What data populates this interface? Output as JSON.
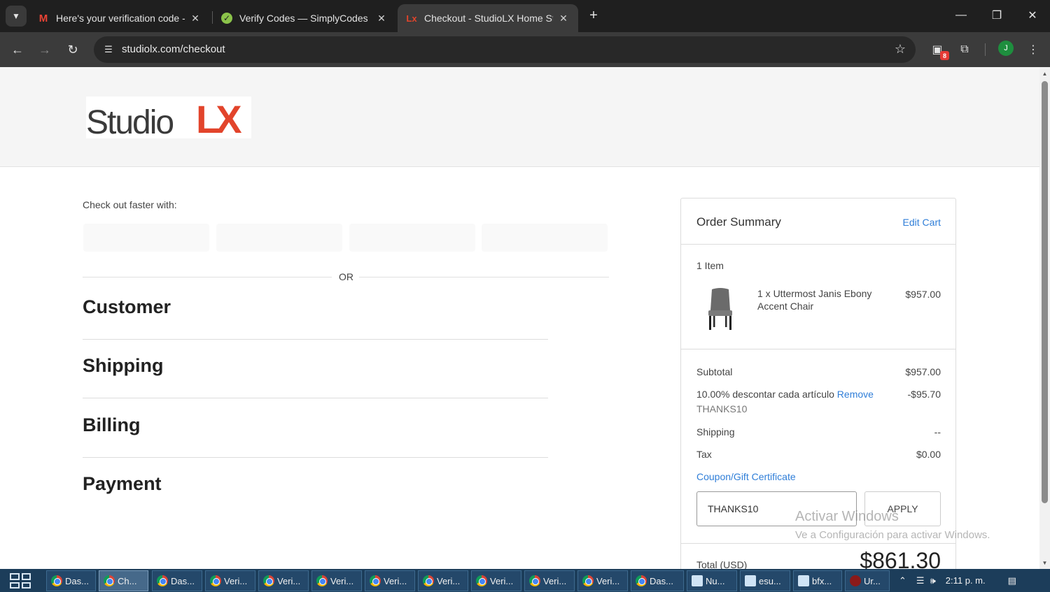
{
  "browser": {
    "tabs": [
      {
        "title": "Here's your verification code - j",
        "icon": "gmail-icon",
        "active": false
      },
      {
        "title": "Verify Codes — SimplyCodes",
        "icon": "simplycodes-icon",
        "active": false
      },
      {
        "title": "Checkout - StudioLX Home Stor",
        "icon": "studiolx-icon",
        "active": true
      }
    ],
    "new_tab": "+",
    "url": "studiolx.com/checkout",
    "extension_badge": "8",
    "profile_initial": "J"
  },
  "header": {
    "logo_main": "Studio",
    "logo_accent": "LX"
  },
  "checkout": {
    "faster_label": "Check out faster with:",
    "or_label": "OR",
    "steps": [
      "Customer",
      "Shipping",
      "Billing",
      "Payment"
    ]
  },
  "summary": {
    "title": "Order Summary",
    "edit_cart": "Edit Cart",
    "item_count": "1 Item",
    "item_name": "1 x Uttermost Janis Ebony Accent Chair",
    "item_price": "$957.00",
    "subtotal_label": "Subtotal",
    "subtotal_value": "$957.00",
    "discount_label": "10.00% descontar cada artículo",
    "discount_remove": "Remove",
    "discount_code": "THANKS10",
    "discount_value": "-$95.70",
    "shipping_label": "Shipping",
    "shipping_value": "--",
    "tax_label": "Tax",
    "tax_value": "$0.00",
    "coupon_link": "Coupon/Gift Certificate",
    "coupon_value": "THANKS10",
    "apply_label": "APPLY",
    "total_label": "Total (USD)",
    "total_value": "$861.30"
  },
  "watermark": {
    "line1": "Activar Windows",
    "line2": "Ve a Configuración para activar Windows."
  },
  "taskbar": {
    "apps": [
      {
        "label": "Das...",
        "icon": "chrome-icon"
      },
      {
        "label": "Ch...",
        "icon": "chrome-icon",
        "active": true
      },
      {
        "label": "Das...",
        "icon": "chrome-icon"
      },
      {
        "label": "Veri...",
        "icon": "chrome-icon"
      },
      {
        "label": "Veri...",
        "icon": "chrome-icon"
      },
      {
        "label": "Veri...",
        "icon": "chrome-icon"
      },
      {
        "label": "Veri...",
        "icon": "chrome-icon"
      },
      {
        "label": "Veri...",
        "icon": "chrome-icon"
      },
      {
        "label": "Veri...",
        "icon": "chrome-icon"
      },
      {
        "label": "Veri...",
        "icon": "chrome-icon"
      },
      {
        "label": "Veri...",
        "icon": "chrome-icon"
      },
      {
        "label": "Das...",
        "icon": "chrome-icon"
      },
      {
        "label": "Nu...",
        "icon": "notepad-icon"
      },
      {
        "label": "esu...",
        "icon": "notepad-icon"
      },
      {
        "label": "bfx...",
        "icon": "notepad-icon"
      },
      {
        "label": "Ur...",
        "icon": "recorder-icon"
      }
    ],
    "clock": "2:11 p. m."
  }
}
